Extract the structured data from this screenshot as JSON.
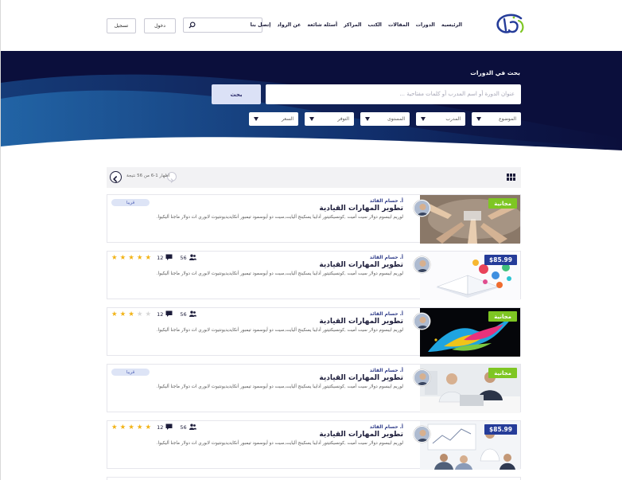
{
  "header": {
    "logo": "أوادي",
    "nav": [
      "الرئيسية",
      "الدورات",
      "المقالات",
      "الكتب",
      "المراكز",
      "أسئلة شائعة",
      "عن الرواد",
      "إتصل بنا"
    ],
    "login": "دخول",
    "register": "تسجيل"
  },
  "hero": {
    "title": "بحث في الدورات",
    "placeholder": "عنوان الدورة أو اسم المدرب أو كلمات مفتاحية ...",
    "button": "بحث",
    "filters": [
      "الموضوع",
      "المدرب",
      "المستوى",
      "التوفر",
      "السعر"
    ]
  },
  "toolbar": {
    "results": "اظهار 1-6 من 56 نتيجة"
  },
  "colors": {
    "accent": "#253c99",
    "free": "#7ec623",
    "hero_bg": "#0b0f3c",
    "star": "#f2b316"
  },
  "cards": [
    {
      "instructor": "أ. حسام القائد",
      "title": "تطوير  المهارات القيادية",
      "desc": "لوريم ايبسوم دولار سيت أميت ,كونسيكتيتور أدايبا يسكينج أليايت,سيت دو أيوسمود تيمبور  أنكايديديونتيوت لابوري ات دولار ماجنا أليكيوا.",
      "badge": "مجانية",
      "badge_type": "free",
      "status": "قريبا",
      "image": "thumb-hands-pointing"
    },
    {
      "instructor": "أ. حسام القائد",
      "title": "تطوير  المهارات القيادية",
      "desc": "لوريم ايبسوم دولار سيت أميت ,كونسيكتيتور أدايبا يسكينج أليايت,سيت دو أيوسمود تيمبور  أنكايديديونتيوت لابوري ات دولار ماجنا أليكيوا.",
      "badge": "$85.99",
      "badge_type": "price",
      "students": "56",
      "lessons": "12",
      "rating": 5,
      "image": "thumb-book-icons"
    },
    {
      "instructor": "أ. حسام القائد",
      "title": "تطوير  المهارات القيادية",
      "desc": "لوريم ايبسوم دولار سيت أميت ,كونسيكتيتور أدايبا يسكينج أليايت,سيت دو أيوسمود تيمبور  أنكايديديونتيوت لابوري ات دولار ماجنا أليكيوا.",
      "badge": "مجانية",
      "badge_type": "free",
      "students": "56",
      "lessons": "12",
      "rating": 3,
      "image": "thumb-color-splash"
    },
    {
      "instructor": "أ. حسام القائد",
      "title": "تطوير  المهارات القيادية",
      "desc": "لوريم ايبسوم دولار سيت أميت ,كونسيكتيتور أدايبا يسكينج أليايت,سيت دو أيوسمود تيمبور  أنكايديديونتيوت لابوري ات دولار ماجنا أليكيوا.",
      "badge": "مجانية",
      "badge_type": "free",
      "status": "قريبا",
      "image": "thumb-meeting"
    },
    {
      "instructor": "أ. حسام القائد",
      "title": "تطوير  المهارات القيادية",
      "desc": "لوريم ايبسوم دولار سيت أميت ,كونسيكتيتور أدايبا يسكينج أليايت,سيت دو أيوسمود تيمبور  أنكايديديونتيوت لابوري ات دولار ماجنا أليكيوا.",
      "badge": "$85.99",
      "badge_type": "price",
      "students": "56",
      "lessons": "12",
      "rating": 5,
      "image": "thumb-presentation"
    }
  ]
}
